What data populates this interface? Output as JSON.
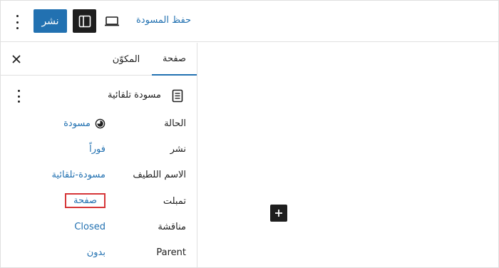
{
  "toolbar": {
    "publish_label": "نشر",
    "save_draft_label": "حفظ المسودة",
    "options_icon": "more-vertical-icon",
    "sidebar_toggle_icon": "sidebar-icon",
    "preview_icon": "laptop-icon"
  },
  "sidebar": {
    "tabs": [
      {
        "label": "صفحة",
        "active": true
      },
      {
        "label": "المكوّن",
        "active": false
      }
    ],
    "close_icon": "close-icon",
    "post": {
      "title": "مسودة تلقائية",
      "icon": "page-icon"
    },
    "rows": [
      {
        "label": "الحالة",
        "value": "مسودة",
        "icon": "draft-status-icon"
      },
      {
        "label": "نشر",
        "value": "فوراً"
      },
      {
        "label": "الاسم اللطيف",
        "value": "مسودة-تلقائية"
      },
      {
        "label": "تمبلت",
        "value": "صفحة"
      },
      {
        "label": "مناقشة",
        "value": "Closed"
      },
      {
        "label": "Parent",
        "value": "بدون"
      }
    ]
  },
  "canvas": {
    "add_block_icon": "plus-icon"
  },
  "colors": {
    "accent": "#2271b1",
    "dark": "#1e1e1e",
    "highlight": "#d63638",
    "border": "#e0e0e0"
  }
}
